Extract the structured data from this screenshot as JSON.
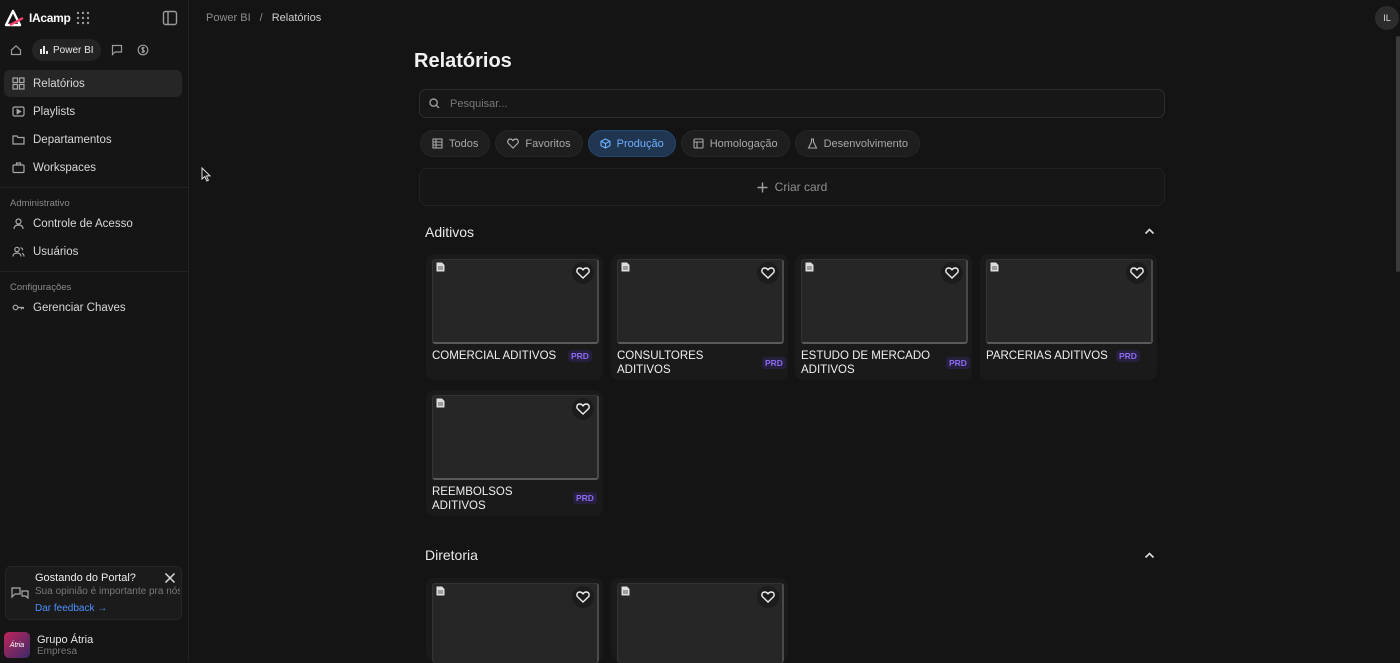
{
  "app": {
    "logo_text": "IAcamp"
  },
  "modules": {
    "active": "Power BI"
  },
  "sidebar": {
    "items": [
      {
        "label": "Relatórios",
        "icon": "grid-icon",
        "active": true
      },
      {
        "label": "Playlists",
        "icon": "playlist-icon"
      },
      {
        "label": "Departamentos",
        "icon": "folder-icon"
      },
      {
        "label": "Workspaces",
        "icon": "briefcase-icon"
      }
    ],
    "admin_label": "Administrativo",
    "admin_items": [
      {
        "label": "Controle de Acesso",
        "icon": "shield-icon"
      },
      {
        "label": "Usuários",
        "icon": "users-icon"
      }
    ],
    "config_label": "Configurações",
    "config_items": [
      {
        "label": "Gerenciar Chaves",
        "icon": "key-icon"
      }
    ]
  },
  "feedback": {
    "title": "Gostando do Portal?",
    "subtitle": "Sua opinião é importante pra nós",
    "link": "Dar feedback →"
  },
  "account": {
    "name": "Grupo Átria",
    "role": "Empresa",
    "logo_text": "Átria"
  },
  "breadcrumb": {
    "root": "Power BI",
    "sep": "/",
    "current": "Relatórios"
  },
  "user": {
    "initials": "IL"
  },
  "page": {
    "title": "Relatórios"
  },
  "search": {
    "placeholder": "Pesquisar..."
  },
  "filters": [
    {
      "label": "Todos",
      "icon": "table-icon",
      "active": false
    },
    {
      "label": "Favoritos",
      "icon": "heart-icon",
      "active": false
    },
    {
      "label": "Produção",
      "icon": "cube-icon",
      "active": true
    },
    {
      "label": "Homologação",
      "icon": "layout-icon",
      "active": false
    },
    {
      "label": "Desenvolvimento",
      "icon": "flask-icon",
      "active": false
    }
  ],
  "create_card": {
    "label": "Criar card"
  },
  "sections": [
    {
      "title": "Aditivos",
      "cards": [
        {
          "title": "COMERCIAL ADITIVOS",
          "badge": "PRD"
        },
        {
          "title": "CONSULTORES ADITIVOS",
          "badge": "PRD"
        },
        {
          "title": "ESTUDO DE MERCADO ADITIVOS",
          "badge": "PRD"
        },
        {
          "title": "PARCERIAS ADITIVOS",
          "badge": "PRD"
        },
        {
          "title": "REEMBOLSOS ADITIVOS",
          "badge": "PRD"
        }
      ]
    },
    {
      "title": "Diretoria",
      "cards": [
        {
          "title": "",
          "badge": ""
        },
        {
          "title": "",
          "badge": ""
        }
      ]
    }
  ]
}
